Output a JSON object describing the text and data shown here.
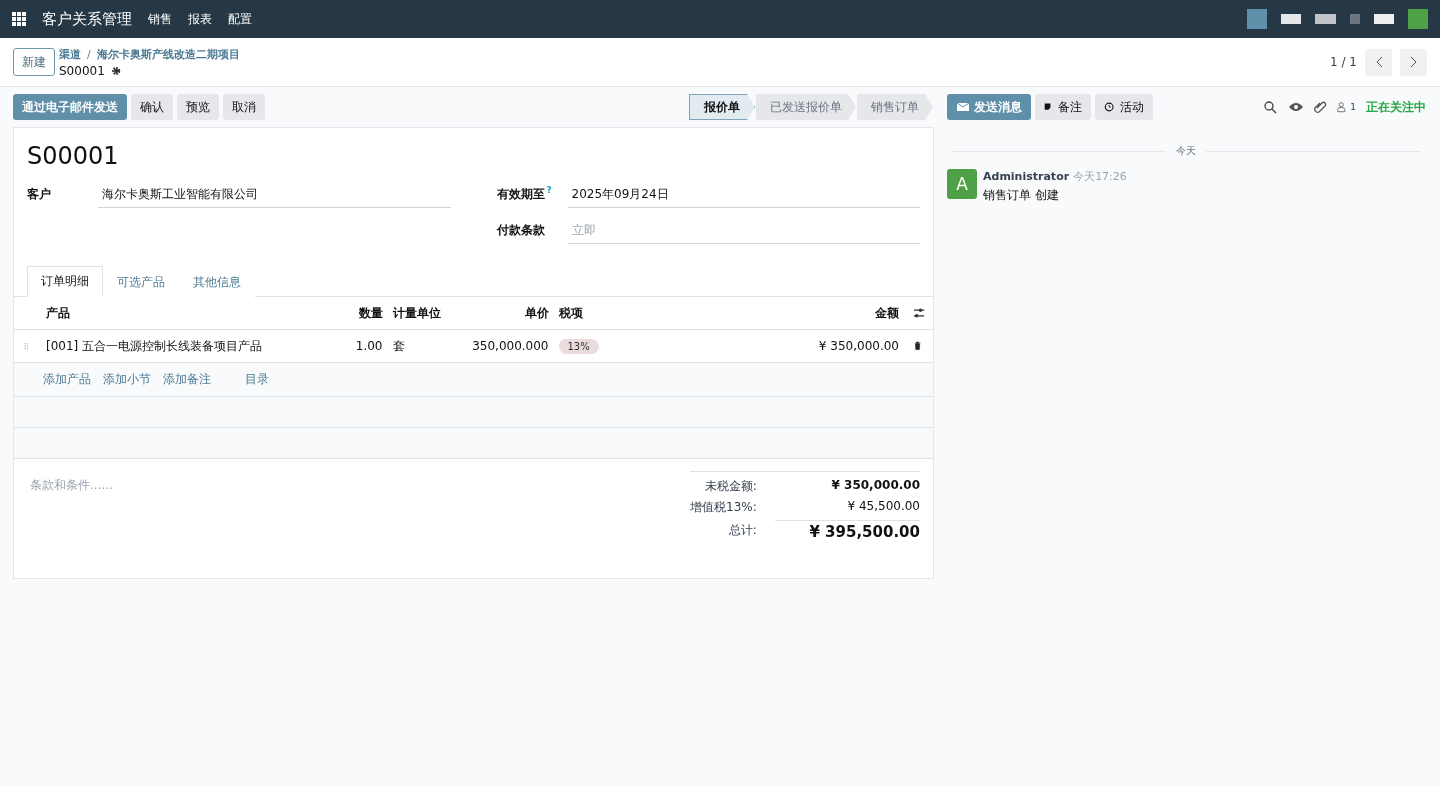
{
  "navbar": {
    "app_title": "客户关系管理",
    "menu": [
      "销售",
      "报表",
      "配置"
    ]
  },
  "control_panel": {
    "new_button": "新建",
    "breadcrumb": [
      "渠道",
      "海尔卡奥斯产线改造二期项目"
    ],
    "separator": "/",
    "record": "S00001",
    "pager": "1 / 1"
  },
  "actions": [
    {
      "label": "通过电子邮件发送",
      "kind": "primary"
    },
    {
      "label": "确认",
      "kind": "secondary"
    },
    {
      "label": "预览",
      "kind": "secondary"
    },
    {
      "label": "取消",
      "kind": "secondary"
    }
  ],
  "stages": [
    {
      "label": "报价单",
      "selected": true
    },
    {
      "label": "已发送报价单",
      "selected": false
    },
    {
      "label": "销售订单",
      "selected": false
    }
  ],
  "form": {
    "title": "S00001",
    "left_fields": [
      {
        "label": "客户",
        "value": "海尔卡奥斯工业智能有限公司"
      }
    ],
    "right_fields": [
      {
        "label": "有效期至",
        "help": "?",
        "value": "2025年09月24日"
      },
      {
        "label": "付款条款",
        "placeholder": "立即"
      }
    ],
    "tabs": [
      {
        "label": "订单明细",
        "selected": true
      },
      {
        "label": "可选产品",
        "selected": false
      },
      {
        "label": "其他信息",
        "selected": false
      }
    ],
    "table": {
      "columns": [
        "产品",
        "数量",
        "计量单位",
        "单价",
        "税项",
        "金额"
      ],
      "rows": [
        {
          "product": "[001] 五合一电源控制长线装备项目产品",
          "quantity": "1.00",
          "uom": "套",
          "price": "350,000.000",
          "tax": "13%",
          "amount": "¥ 350,000.00"
        }
      ],
      "add_links": [
        "添加产品",
        "添加小节",
        "添加备注",
        "目录"
      ]
    },
    "terms_placeholder": "条款和条件......",
    "totals": [
      {
        "label": "未税金额:",
        "value": "¥ 350,000.00",
        "kind": "subtotal"
      },
      {
        "label": "增值税13%:",
        "value": "¥ 45,500.00",
        "kind": "tax"
      },
      {
        "label": "总计:",
        "value": "¥ 395,500.00",
        "kind": "total"
      }
    ]
  },
  "chatter": {
    "buttons": [
      {
        "label": "发送消息",
        "kind": "primary"
      },
      {
        "label": "备注",
        "kind": "note"
      },
      {
        "label": "活动",
        "kind": "activity"
      }
    ],
    "follower_count": "1",
    "following": "正在关注中",
    "date_separator": "今天",
    "messages": [
      {
        "avatar": "A",
        "author": "Administrator",
        "time": "今天17:26",
        "body": "销售订单 创建"
      }
    ]
  }
}
